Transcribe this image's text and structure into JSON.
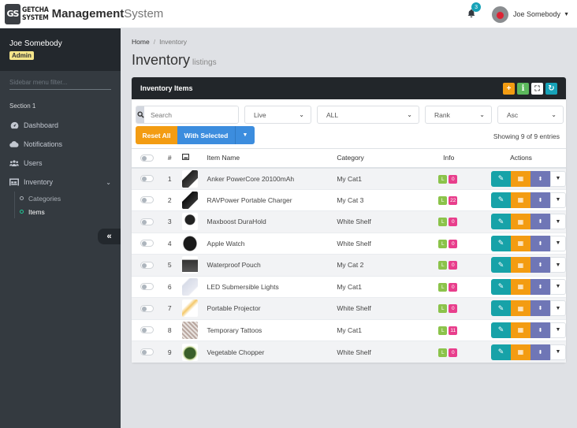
{
  "app": {
    "logo_mark": "GS",
    "logo_text_line1": "GETCHA",
    "logo_text_line2": "SYSTEM",
    "brand_bold": "Management",
    "brand_light": "System"
  },
  "topbar": {
    "notification_count": "3",
    "user_name": "Joe Somebody",
    "icons": {
      "bell": "bell-icon",
      "caret": "caret-down-icon",
      "avatar": "user-avatar"
    }
  },
  "sidebar": {
    "user_name": "Joe Somebody",
    "role_badge": "Admin",
    "filter_placeholder": "Sidebar menu filter...",
    "section_label": "Section 1",
    "items": [
      {
        "label": "Dashboard",
        "icon": "dashboard-icon"
      },
      {
        "label": "Notifications",
        "icon": "cloud-icon"
      },
      {
        "label": "Users",
        "icon": "users-icon"
      },
      {
        "label": "Inventory",
        "icon": "warehouse-icon",
        "expanded": true
      }
    ],
    "subitems": [
      {
        "label": "Categories",
        "active": false
      },
      {
        "label": "Items",
        "active": true
      }
    ],
    "collapse_icon": "double-chevron-left-icon"
  },
  "breadcrumb": {
    "home": "Home",
    "separator": "/",
    "current": "Inventory"
  },
  "page": {
    "title": "Inventory",
    "subtitle": "listings"
  },
  "card": {
    "title": "Inventory Items",
    "tools": [
      {
        "name": "add",
        "glyph": "+",
        "color": "#f39c12"
      },
      {
        "name": "info",
        "glyph": "i",
        "color": "#8bc34a"
      },
      {
        "name": "fullscreen",
        "glyph": "⛶",
        "color": "#ffffff"
      },
      {
        "name": "refresh",
        "glyph": "↻",
        "color": "#17a2b8"
      }
    ]
  },
  "filters": {
    "search_placeholder": "Search",
    "status": "Live",
    "category": "ALL",
    "sort_by": "Rank",
    "order": "Asc"
  },
  "buttons": {
    "reset_all": "Reset All",
    "with_selected": "With Selected"
  },
  "entries_text": "Showing 9 of 9 entries",
  "colors": {
    "teal": "#17a2a8",
    "orange": "#f39c12",
    "purple": "#6f76b6",
    "green": "#8bc34a",
    "pink": "#e83e8c",
    "blue": "#3c8dde"
  },
  "table": {
    "headers": {
      "num": "#",
      "name": "Item Name",
      "category": "Category",
      "info": "Info",
      "actions": "Actions"
    },
    "rows": [
      {
        "num": "1",
        "name": "Anker PowerCore 20100mAh",
        "category": "My Cat1",
        "l": "L",
        "count": "0"
      },
      {
        "num": "2",
        "name": "RAVPower Portable Charger",
        "category": "My Cat 3",
        "l": "L",
        "count": "22"
      },
      {
        "num": "3",
        "name": "Maxboost DuraHold",
        "category": "White Shelf",
        "l": "L",
        "count": "0"
      },
      {
        "num": "4",
        "name": "Apple Watch",
        "category": "White Shelf",
        "l": "L",
        "count": "0"
      },
      {
        "num": "5",
        "name": "Waterproof Pouch",
        "category": "My Cat 2",
        "l": "L",
        "count": "0"
      },
      {
        "num": "6",
        "name": "LED Submersible Lights",
        "category": "My Cat1",
        "l": "L",
        "count": "0"
      },
      {
        "num": "7",
        "name": "Portable Projector",
        "category": "White Shelf",
        "l": "L",
        "count": "0"
      },
      {
        "num": "8",
        "name": "Temporary Tattoos",
        "category": "My Cat1",
        "l": "L",
        "count": "11"
      },
      {
        "num": "9",
        "name": "Vegetable Chopper",
        "category": "White Shelf",
        "l": "L",
        "count": "0"
      }
    ]
  }
}
